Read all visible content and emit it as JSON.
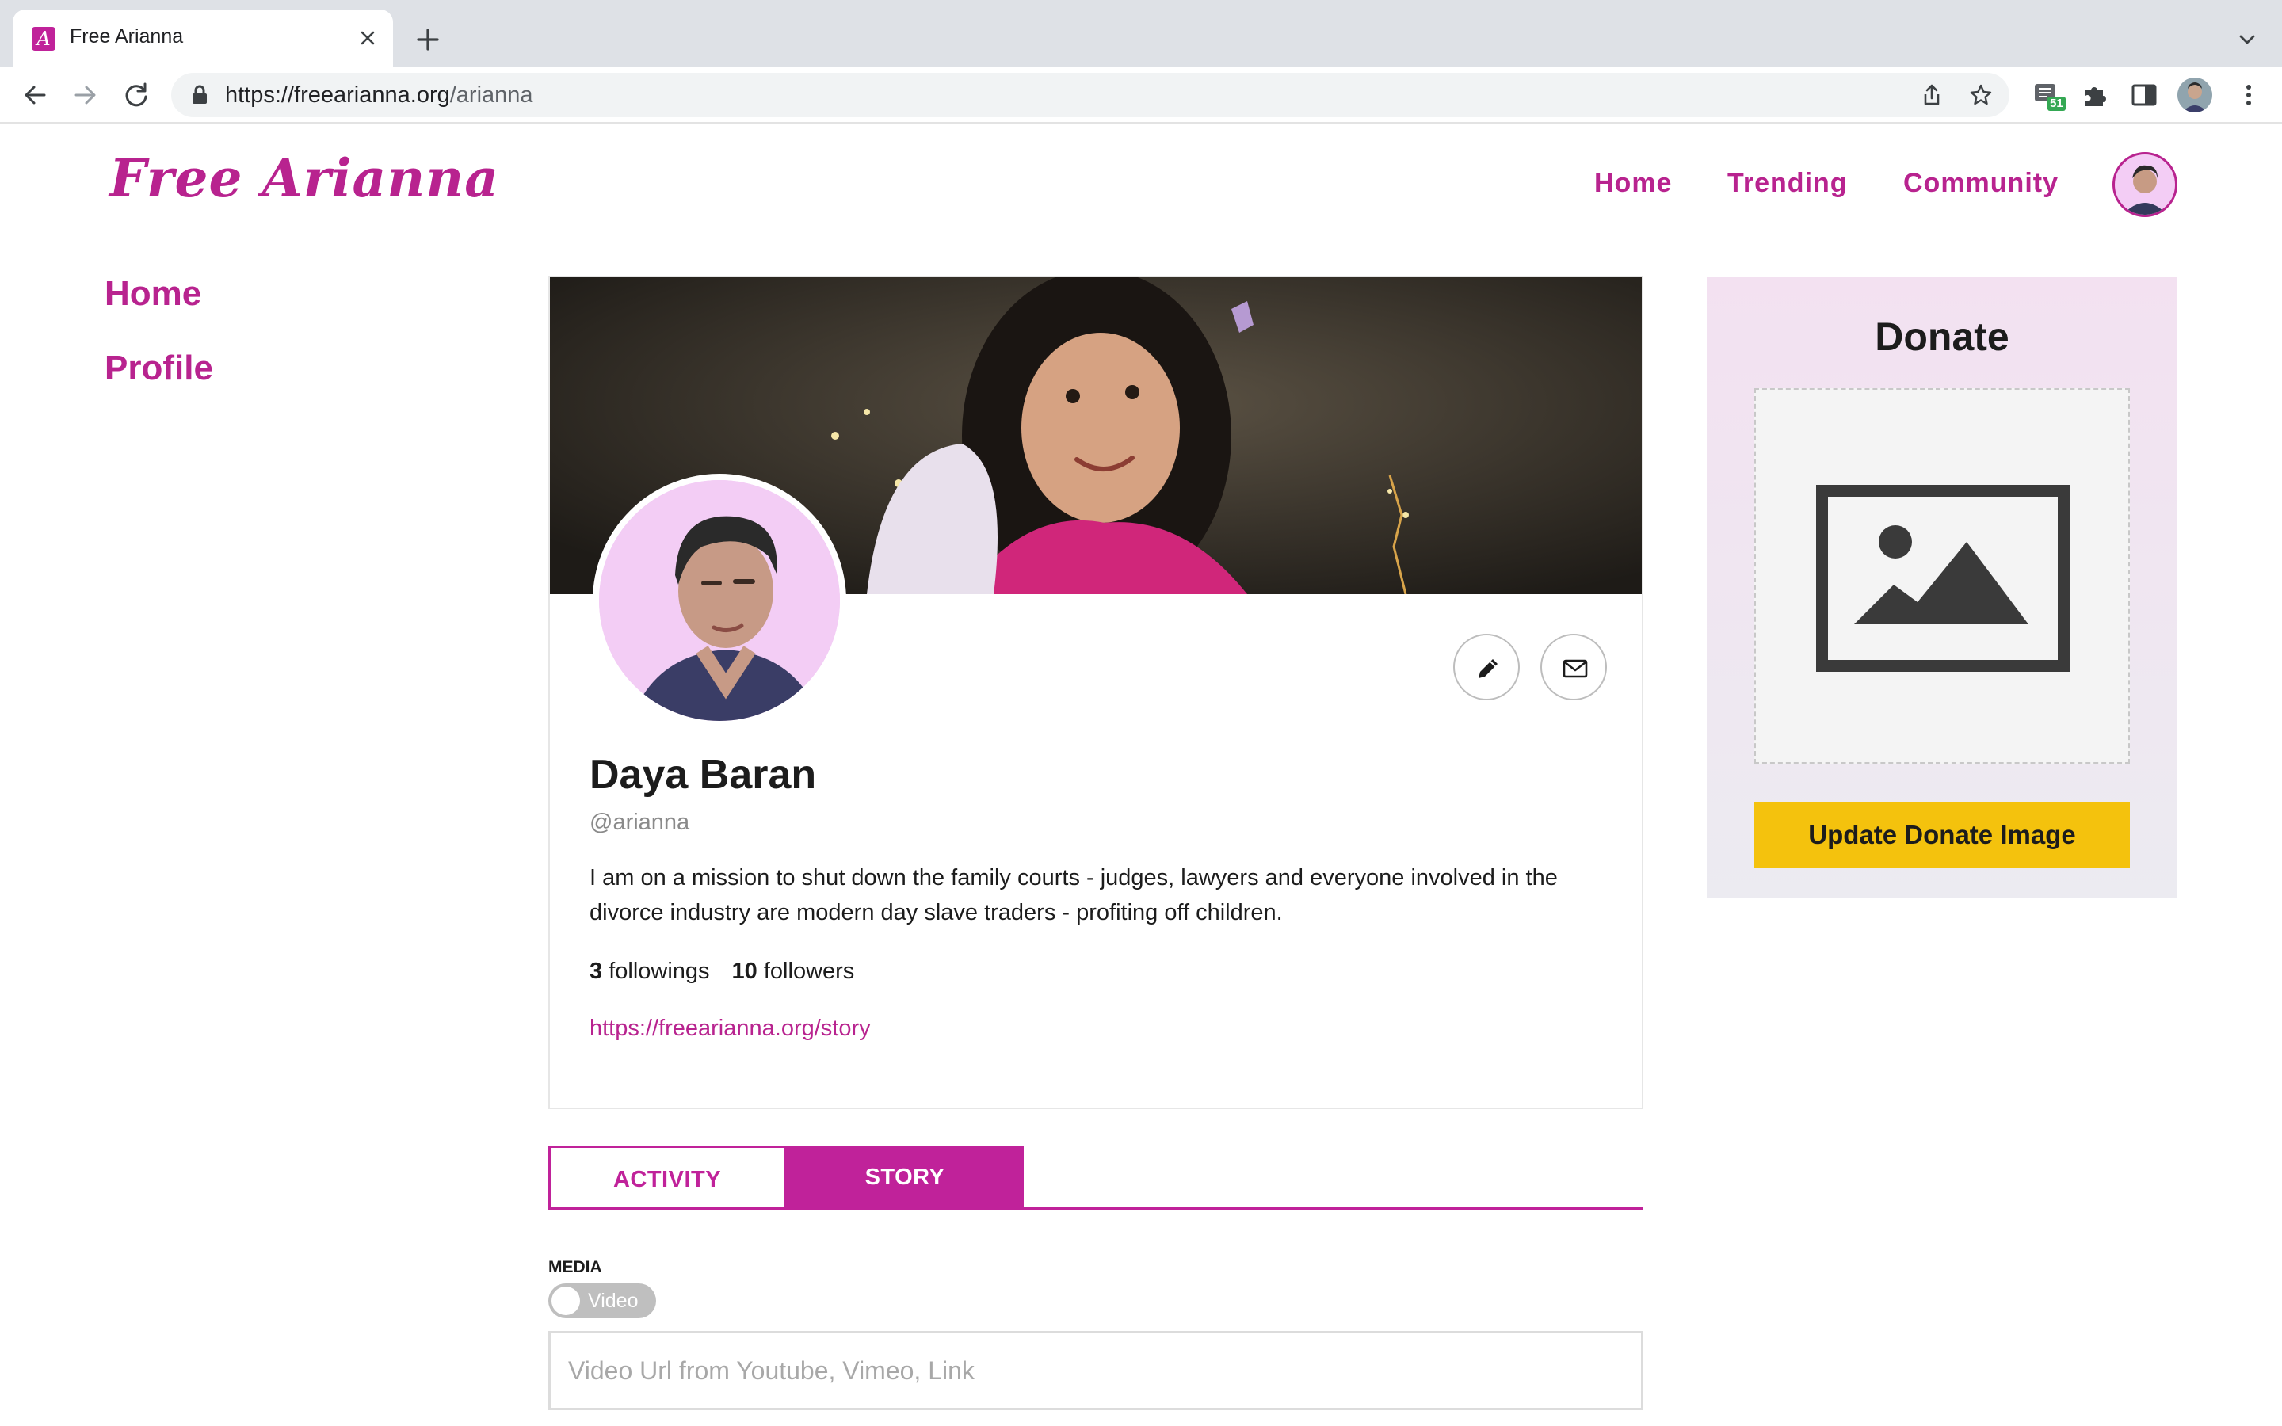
{
  "browser": {
    "tab_title": "Free Arianna",
    "favicon_letter": "A",
    "url_host": "https://freearianna.org",
    "url_path": "/arianna",
    "extension_badge": "51"
  },
  "site": {
    "logo": "Free Arianna",
    "nav": [
      "Home",
      "Trending",
      "Community"
    ],
    "accent_color": "#b8238f"
  },
  "sidebar": {
    "items": [
      "Home",
      "Profile"
    ]
  },
  "profile": {
    "name": "Daya Baran",
    "handle": "@arianna",
    "bio": "I am on a mission to shut down the family courts - judges, lawyers and everyone involved in the divorce industry are modern day slave traders - profiting off children.",
    "followings_count": "3",
    "followings_label": "followings",
    "followers_count": "10",
    "followers_label": "followers",
    "link": "https://freearianna.org/story"
  },
  "tabs": {
    "activity": "ACTIVITY",
    "story": "STORY",
    "active": "STORY"
  },
  "media": {
    "label": "MEDIA",
    "toggle_label": "Video",
    "input_placeholder": "Video Url from Youtube, Vimeo, Link",
    "input_value": ""
  },
  "donate": {
    "title": "Donate",
    "button": "Update Donate Image",
    "button_color": "#f4c20d"
  }
}
